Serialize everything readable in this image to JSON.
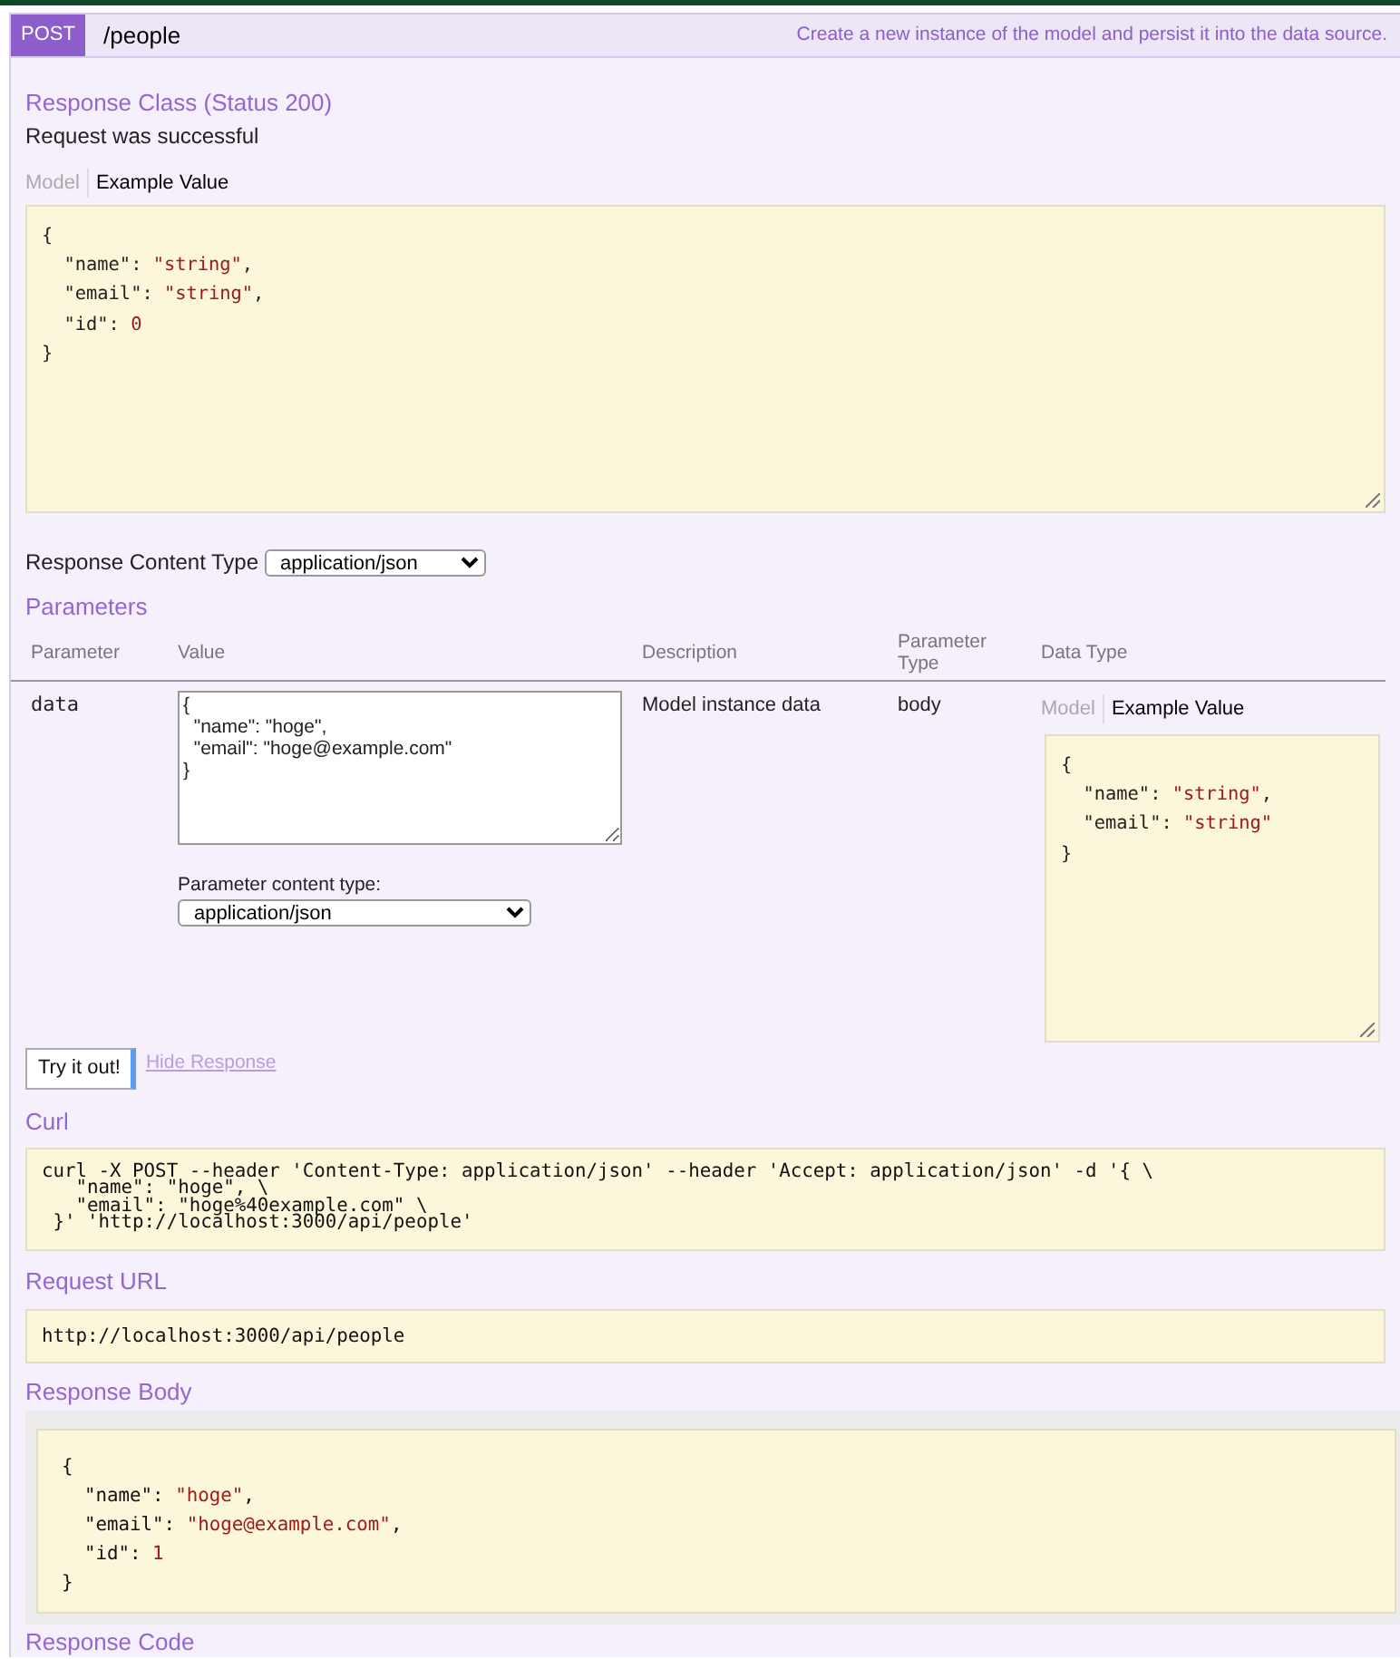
{
  "operation": {
    "method": "POST",
    "path": "/people",
    "summary": "Create a new instance of the model and persist it into the data source."
  },
  "response_class": {
    "title": "Response Class (Status 200)",
    "message": "Request was successful",
    "tabs": [
      {
        "label": "Model",
        "selected": false
      },
      {
        "label": "Example Value",
        "selected": true
      }
    ],
    "example": [
      "{",
      "  \"name\": \"string\",",
      "  \"email\": \"string\",",
      "  \"id\": 0",
      "}"
    ]
  },
  "response_content_type": {
    "label": "Response Content Type",
    "value": "application/json"
  },
  "parameters": {
    "title": "Parameters",
    "columns": [
      "Parameter",
      "Value",
      "Description",
      "Parameter Type",
      "Data Type"
    ],
    "rows": [
      {
        "name": "data",
        "value": "{\n  \"name\": \"hoge\",\n  \"email\": \"hoge@example.com\"\n}",
        "content_type_label": "Parameter content type:",
        "content_type": "application/json",
        "description": "Model instance data",
        "parameter_type": "body",
        "tabs": [
          {
            "label": "Model",
            "selected": false
          },
          {
            "label": "Example Value",
            "selected": true
          }
        ],
        "example": [
          "{",
          "  \"name\": \"string\",",
          "  \"email\": \"string\"",
          "}"
        ]
      }
    ]
  },
  "actions": {
    "try_button": {
      "label": "Try it out!",
      "focused": true
    },
    "hide_link": "Hide Response"
  },
  "curl": {
    "title": "Curl",
    "command": "curl -X POST --header 'Content-Type: application/json' --header 'Accept: application/json' -d '{ \\\n   \"name\": \"hoge\", \\\n   \"email\": \"hoge%40example.com\" \\\n }' 'http://localhost:3000/api/people'"
  },
  "request_url": {
    "title": "Request URL",
    "value": "http://localhost:3000/api/people"
  },
  "response_body": {
    "title": "Response Body",
    "lines": [
      "{",
      "  \"name\": \"hoge\",",
      "  \"email\": \"hoge@example.com\",",
      "  \"id\": 1",
      "}"
    ]
  },
  "response_code": {
    "title": "Response Code"
  }
}
